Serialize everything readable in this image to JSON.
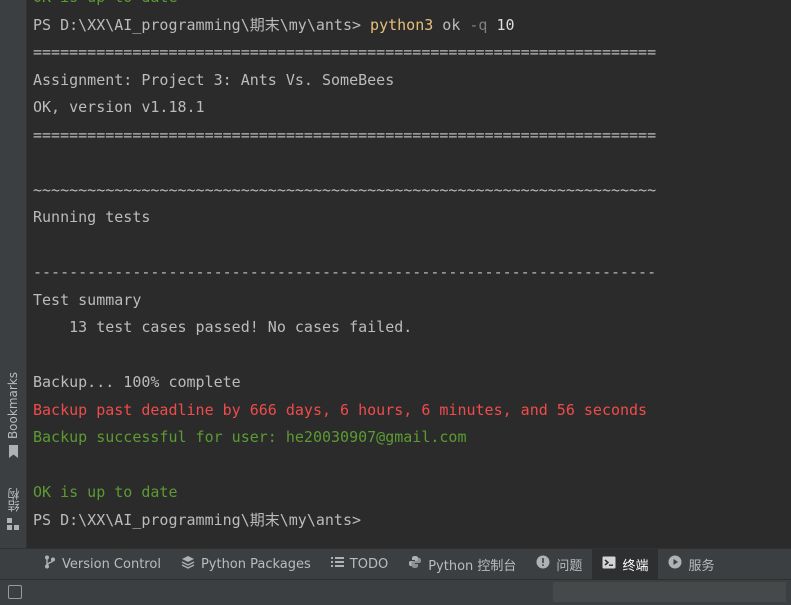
{
  "terminal": {
    "top_partial": "OK is up to date",
    "prompt1": "PS D:\\XX\\AI_programming\\期末\\my\\ants>",
    "cmd": "python3",
    "arg1": "ok",
    "flag": "-q",
    "num": "10",
    "sep1": "=====================================================================",
    "assignment": "Assignment: Project 3: Ants Vs. SomeBees",
    "version": "OK, version v1.18.1",
    "sep2": "=====================================================================",
    "tilde": "~~~~~~~~~~~~~~~~~~~~~~~~~~~~~~~~~~~~~~~~~~~~~~~~~~~~~~~~~~~~~~~~~~~~~",
    "running": "Running tests",
    "dash": "---------------------------------------------------------------------",
    "summary": "Test summary",
    "passed": "    13 test cases passed! No cases failed.",
    "backup": "Backup... 100% complete",
    "deadline": "Backup past deadline by 666 days, 6 hours, 6 minutes, and 56 seconds",
    "success": "Backup successful for user: he20030907@gmail.com",
    "ok_date": "OK is up to date",
    "prompt2": "PS D:\\XX\\AI_programming\\期末\\my\\ants>"
  },
  "sidebar": {
    "bookmarks": "Bookmarks",
    "structure": "结构"
  },
  "toolwindows": [
    {
      "label": "Version Control",
      "icon": "branch-icon"
    },
    {
      "label": "Python Packages",
      "icon": "layers-icon"
    },
    {
      "label": "TODO",
      "icon": "list-icon"
    },
    {
      "label": "Python 控制台",
      "icon": "python-icon"
    },
    {
      "label": "问题",
      "icon": "info-icon"
    },
    {
      "label": "终端",
      "icon": "terminal-icon",
      "active": true
    },
    {
      "label": "服务",
      "icon": "play-icon"
    }
  ],
  "colors": {
    "background": "#2b2b2b",
    "green": "#5b9b32",
    "red": "#f04b4b",
    "yellow": "#e5c07b",
    "text": "#bbbbbb"
  }
}
